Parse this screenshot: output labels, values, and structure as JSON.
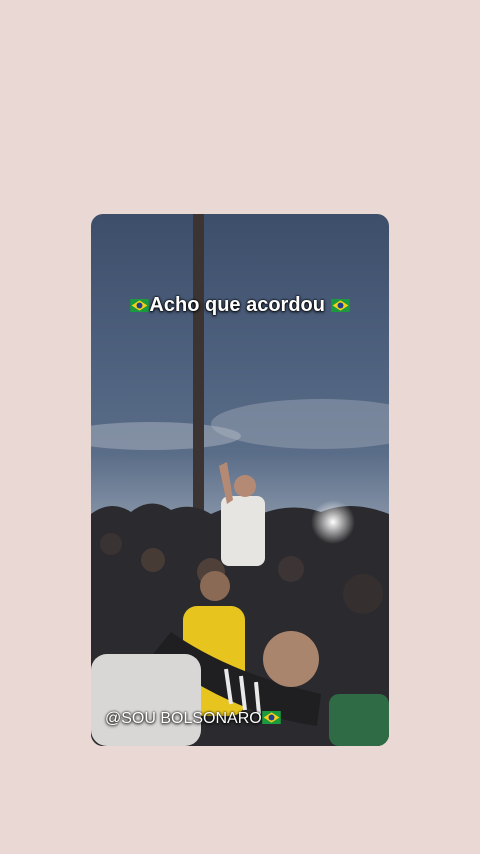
{
  "story": {
    "caption": "Acho que acordou",
    "watermark": "@SOU BOLSONARO",
    "flag_icon": "brazil-flag-icon"
  },
  "colors": {
    "background": "#e9d8d3",
    "flag_green": "#1b9a3e",
    "flag_yellow": "#f7d117",
    "flag_blue": "#1f3f8f",
    "shirt_yellow": "#e7c51e"
  }
}
